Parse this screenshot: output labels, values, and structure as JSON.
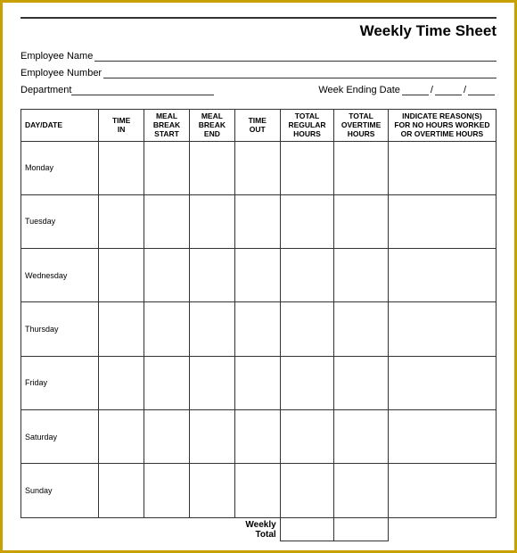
{
  "title": "Weekly Time Sheet",
  "fields": {
    "employee_name_label": "Employee Name",
    "employee_number_label": "Employee Number",
    "department_label": "Department",
    "week_ending_label": "Week Ending Date"
  },
  "table": {
    "headers": [
      {
        "key": "day",
        "label": "DAY/DATE"
      },
      {
        "key": "time_in",
        "label": "TIME\nIN"
      },
      {
        "key": "meal_break_start",
        "label": "MEAL\nBREAK\nSTART"
      },
      {
        "key": "meal_break_end",
        "label": "MEAL\nBREAK\nEND"
      },
      {
        "key": "time_out",
        "label": "TIME\nOUT"
      },
      {
        "key": "total_regular",
        "label": "TOTAL\nREGULAR\nHOURS"
      },
      {
        "key": "total_overtime",
        "label": "TOTAL\nOVERTIME\nHOURS"
      },
      {
        "key": "indicate_reasons",
        "label": "INDICATE REASON(S)\nFOR NO HOURS WORKED\nOR OVERTIME HOURS"
      }
    ],
    "days": [
      "Monday",
      "Tuesday",
      "Wednesday",
      "Thursday",
      "Friday",
      "Saturday",
      "Sunday"
    ],
    "weekly_total_label": "Weekly Total"
  }
}
